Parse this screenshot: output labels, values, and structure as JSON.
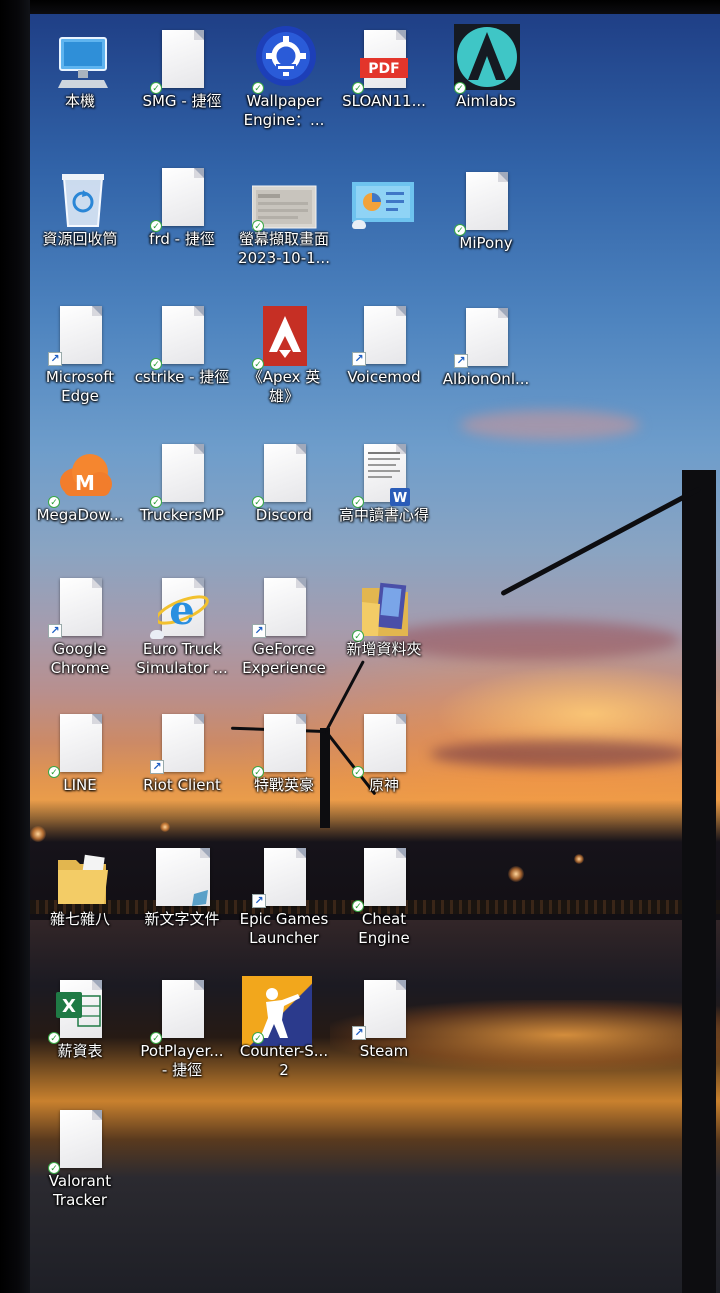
{
  "desktop": {
    "icons": [
      {
        "id": "this-pc",
        "lines": [
          "本機"
        ],
        "icon": "monitor-icon",
        "status": "none"
      },
      {
        "id": "smg",
        "lines": [
          "SMG - 捷徑"
        ],
        "icon": "file-icon",
        "status": "synced"
      },
      {
        "id": "wallpaper-engine",
        "lines": [
          "Wallpaper",
          "Engine：..."
        ],
        "icon": "wallpaper-engine-icon",
        "status": "synced"
      },
      {
        "id": "sloan",
        "lines": [
          "SLOAN11..."
        ],
        "icon": "pdf-icon",
        "status": "synced",
        "glyph_text": "PDF"
      },
      {
        "id": "aimlabs",
        "lines": [
          "Aimlabs"
        ],
        "icon": "aimlabs-icon",
        "status": "synced"
      },
      {
        "id": "recycle-bin",
        "lines": [
          "資源回收筒"
        ],
        "icon": "recycle-bin-icon",
        "status": "none"
      },
      {
        "id": "frd",
        "lines": [
          "frd - 捷徑"
        ],
        "icon": "file-icon",
        "status": "synced"
      },
      {
        "id": "screenshot",
        "lines": [
          "螢幕擷取畫面",
          "2023-10-1..."
        ],
        "icon": "image-thumbnail-icon",
        "status": "synced"
      },
      {
        "id": "slides-doc",
        "lines": [
          ""
        ],
        "icon": "presentation-icon",
        "status": "cloud"
      },
      {
        "id": "mipony",
        "lines": [
          "MiPony"
        ],
        "icon": "file-icon",
        "status": "synced"
      },
      {
        "id": "edge",
        "lines": [
          "Microsoft",
          "Edge"
        ],
        "icon": "file-icon",
        "status": "shortcut"
      },
      {
        "id": "cstrike",
        "lines": [
          "cstrike - 捷徑"
        ],
        "icon": "file-icon",
        "status": "synced"
      },
      {
        "id": "apex",
        "lines": [
          "《Apex 英",
          "雄》"
        ],
        "icon": "apex-icon",
        "status": "synced"
      },
      {
        "id": "voicemod",
        "lines": [
          "Voicemod"
        ],
        "icon": "file-icon",
        "status": "shortcut"
      },
      {
        "id": "albion",
        "lines": [
          "AlbionOnl..."
        ],
        "icon": "file-icon",
        "status": "shortcut"
      },
      {
        "id": "megadownloader",
        "lines": [
          "MegaDow..."
        ],
        "icon": "mega-cloud-icon",
        "status": "synced",
        "glyph_text": "M"
      },
      {
        "id": "truckersmp",
        "lines": [
          "TruckersMP"
        ],
        "icon": "file-icon",
        "status": "synced"
      },
      {
        "id": "discord",
        "lines": [
          "Discord"
        ],
        "icon": "file-icon",
        "status": "synced"
      },
      {
        "id": "book-report",
        "lines": [
          "高中讀書心得"
        ],
        "icon": "word-doc-icon",
        "status": "synced",
        "glyph_text": "W"
      },
      {
        "id": "chrome",
        "lines": [
          "Google",
          "Chrome"
        ],
        "icon": "file-icon",
        "status": "shortcut"
      },
      {
        "id": "ets",
        "lines": [
          "Euro Truck",
          "Simulator ..."
        ],
        "icon": "internet-explorer-icon",
        "status": "cloud",
        "glyph_text": "e"
      },
      {
        "id": "geforce",
        "lines": [
          "GeForce",
          "Experience"
        ],
        "icon": "file-icon",
        "status": "shortcut"
      },
      {
        "id": "new-folder",
        "lines": [
          "新增資料夾"
        ],
        "icon": "folder-icon",
        "status": "synced"
      },
      {
        "id": "line",
        "lines": [
          "LINE"
        ],
        "icon": "file-icon",
        "status": "synced"
      },
      {
        "id": "riot",
        "lines": [
          "Riot Client"
        ],
        "icon": "file-icon",
        "status": "shortcut"
      },
      {
        "id": "valorant",
        "lines": [
          "特戰英豪"
        ],
        "icon": "file-icon",
        "status": "synced"
      },
      {
        "id": "genshin",
        "lines": [
          "原神"
        ],
        "icon": "file-icon",
        "status": "synced"
      },
      {
        "id": "misc-folder",
        "lines": [
          "雜七雜八"
        ],
        "icon": "folder-icon",
        "status": "none"
      },
      {
        "id": "new-text",
        "lines": [
          "新文字文件"
        ],
        "icon": "text-file-icon",
        "status": "none"
      },
      {
        "id": "epic",
        "lines": [
          "Epic Games",
          "Launcher"
        ],
        "icon": "file-icon",
        "status": "shortcut"
      },
      {
        "id": "cheat-engine",
        "lines": [
          "Cheat",
          "Engine"
        ],
        "icon": "file-icon",
        "status": "synced"
      },
      {
        "id": "salary",
        "lines": [
          "薪資表"
        ],
        "icon": "excel-icon",
        "status": "synced",
        "glyph_text": "X"
      },
      {
        "id": "potplayer",
        "lines": [
          "PotPlayer...",
          "- 捷徑"
        ],
        "icon": "file-icon",
        "status": "synced"
      },
      {
        "id": "cs2",
        "lines": [
          "Counter-S...",
          "2"
        ],
        "icon": "counter-strike-icon",
        "status": "synced"
      },
      {
        "id": "steam",
        "lines": [
          "Steam"
        ],
        "icon": "file-icon",
        "status": "shortcut"
      },
      {
        "id": "valorant-tracker",
        "lines": [
          "Valorant",
          "Tracker"
        ],
        "icon": "file-icon",
        "status": "synced"
      }
    ]
  }
}
